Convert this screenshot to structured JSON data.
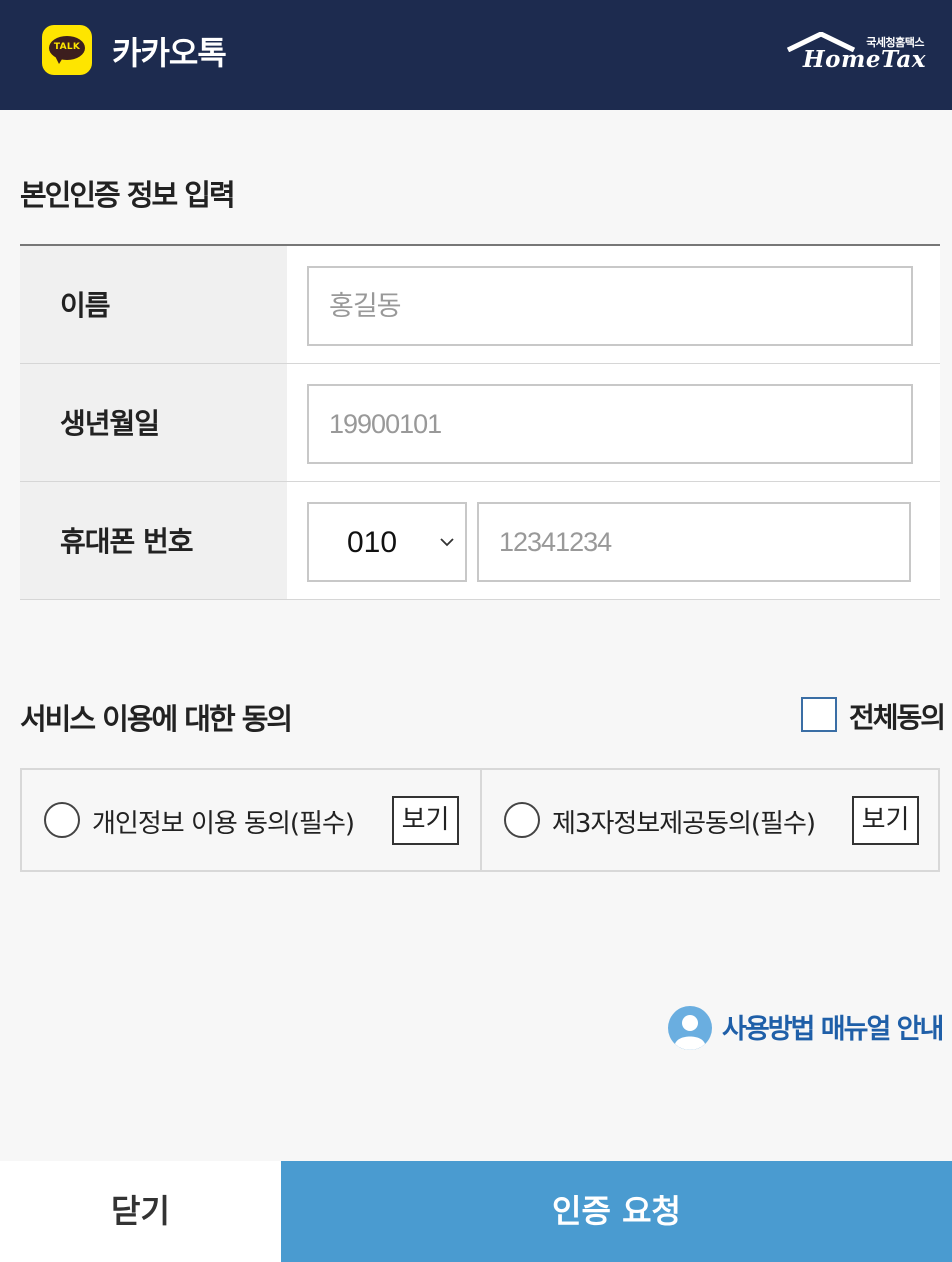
{
  "header": {
    "logo_text": "TALK",
    "title": "카카오톡",
    "brand_sub": "국세청홈택스",
    "brand": "HomeTax"
  },
  "auth_section": {
    "title": "본인인증 정보 입력",
    "fields": {
      "name": {
        "label": "이름",
        "placeholder": "홍길동"
      },
      "birth": {
        "label": "생년월일",
        "placeholder": "19900101"
      },
      "phone": {
        "label": "휴대폰 번호",
        "prefix": "010",
        "placeholder": "12341234"
      }
    }
  },
  "consent_section": {
    "title": "서비스 이용에 대한 동의",
    "agree_all_label": "전체동의",
    "terms": [
      {
        "label": "개인정보 이용 동의(필수)",
        "view_label": "보기"
      },
      {
        "label": "제3자정보제공동의(필수)",
        "view_label": "보기"
      }
    ]
  },
  "manual_link": "사용방법 매뉴얼 안내",
  "footer": {
    "close_label": "닫기",
    "request_label": "인증 요청"
  },
  "colors": {
    "header_bg": "#1d2b4f",
    "kakao_yellow": "#fee500",
    "request_button": "#4a9bd0",
    "link_blue": "#1f5fa8"
  }
}
